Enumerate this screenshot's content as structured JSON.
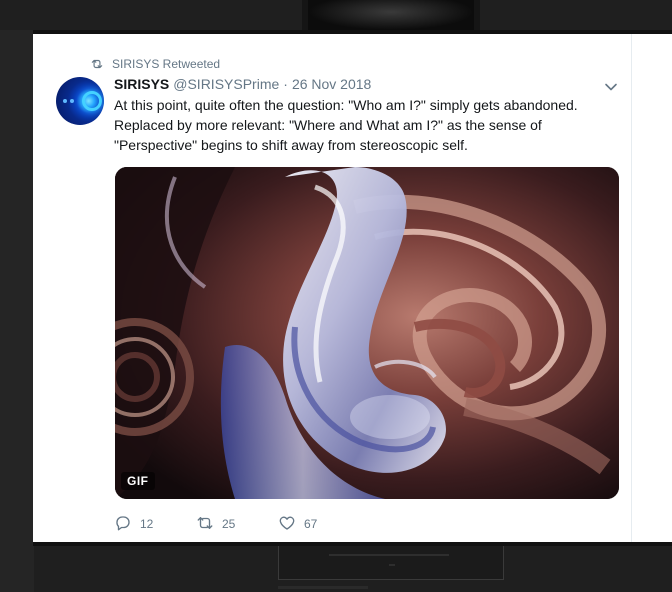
{
  "retweet_notice": {
    "label": "SIRISYS Retweeted",
    "icon": "retweet-icon"
  },
  "author": {
    "display_name": "SIRISYS",
    "handle": "@SIRISYSPrime",
    "separator": "·",
    "date": "26 Nov 2018",
    "avatar_colors": [
      "#06165a",
      "#0a44c8",
      "#44d2ff"
    ]
  },
  "tweet": {
    "text": "At this point, quite often the question: \"Who am I?\" simply gets abandoned. Replaced by more relevant: \"Where and What am I?\" as the sense of \"Perspective\" begins to shift away from stereoscopic self."
  },
  "media": {
    "badge": "GIF"
  },
  "actions": {
    "reply": {
      "count": "12",
      "icon": "reply-icon"
    },
    "retweet": {
      "count": "25",
      "icon": "retweet-icon"
    },
    "like": {
      "count": "67",
      "icon": "heart-icon"
    }
  },
  "menu": {
    "icon": "chevron-down-icon"
  },
  "colors": {
    "text": "#14171a",
    "muted": "#657786",
    "card": "#ffffff",
    "page": "#1f1f1f"
  }
}
